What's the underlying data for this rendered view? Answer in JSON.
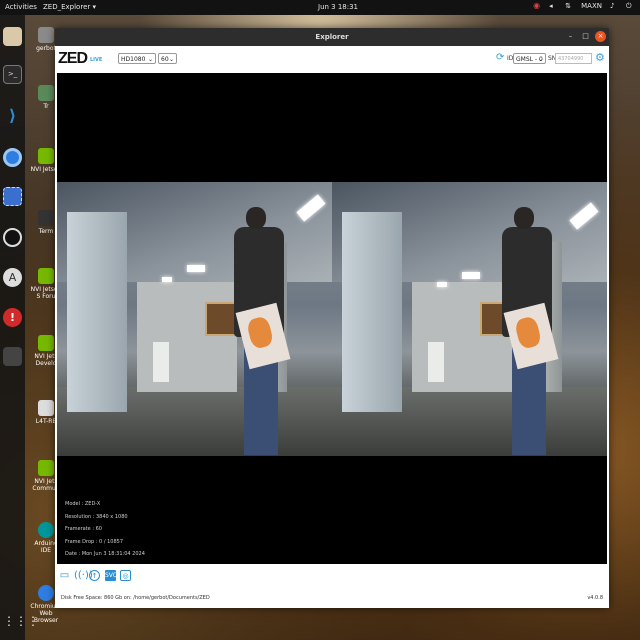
{
  "topbar": {
    "activities": "Activities",
    "app_menu": "ZED_Explorer ▾",
    "clock": "Jun 3  18:31",
    "mode": "MAXN"
  },
  "dock": {
    "icons": [
      "files-icon",
      "terminal-icon",
      "vscode-icon",
      "chromium-icon",
      "screenshot-icon",
      "obs-icon",
      "arduino-icon",
      "help-icon"
    ]
  },
  "desktop": {
    "icons": [
      {
        "label": "gerbot"
      },
      {
        "label": "Tr"
      },
      {
        "label": "NVI Jetson"
      },
      {
        "label": "Term"
      },
      {
        "label": "NVI Jetson S Foru"
      },
      {
        "label": "NVI Jets Develo"
      },
      {
        "label": "L4T-RE"
      },
      {
        "label": "NVI Jets Commun"
      },
      {
        "label": "Arduino IDE"
      },
      {
        "label": "Chromium Web Browser"
      }
    ]
  },
  "window": {
    "title": "Explorer",
    "close": "×",
    "maximize": "□",
    "minimize": "–"
  },
  "toolbar": {
    "logo": "ZED",
    "live": "LIVE",
    "resolution": "HD1080",
    "fps": "60",
    "id_label": "ID",
    "id_value": "GMSL - 0",
    "sn_label": "SN",
    "sn_placeholder": "43704990"
  },
  "info": {
    "model": "Model : ZED-X",
    "resolution": "Resolution : 3840 x 1080",
    "framerate": "Framerate : 60",
    "frame_drop": "Frame Drop : 0 / 10857",
    "date": "Date : Mon Jun 3 18:31:04 2024"
  },
  "bottom": {
    "icons": [
      "folder-icon",
      "stream-icon",
      "network-icon",
      "video-icon",
      "snapshot-icon"
    ],
    "disk": "Disk Free Space: 860 Gb  on: /home/gerbot/Documents/ZED",
    "version": "v4.0.8"
  },
  "colors": {
    "accent": "#2a8fd0",
    "close": "#e95420"
  }
}
